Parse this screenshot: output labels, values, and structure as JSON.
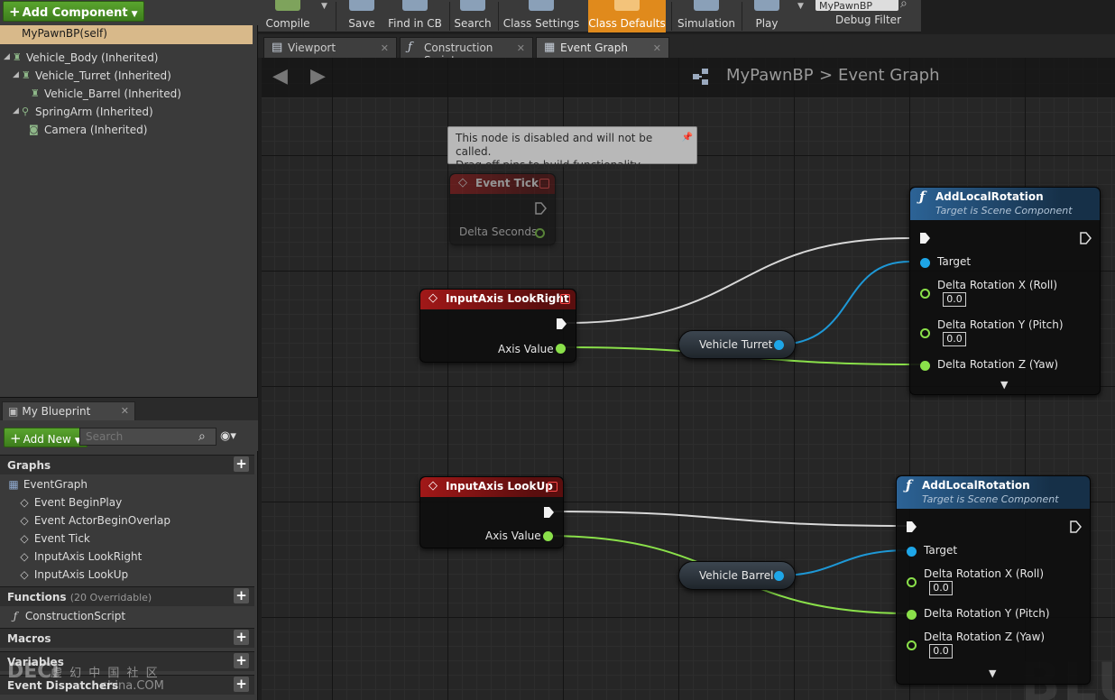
{
  "components": {
    "add_button": "Add Component",
    "self_row": "MyPawnBP(self)",
    "tree": [
      {
        "label": "Vehicle_Body (Inherited)",
        "expanded": true
      },
      {
        "label": "Vehicle_Turret (Inherited)",
        "expanded": true
      },
      {
        "label": "Vehicle_Barrel (Inherited)"
      },
      {
        "label": "SpringArm (Inherited)",
        "expanded": true
      },
      {
        "label": "Camera (Inherited)"
      }
    ]
  },
  "toolbar": {
    "compile": "Compile",
    "save": "Save",
    "find_in_cb": "Find in CB",
    "search": "Search",
    "class_settings": "Class Settings",
    "class_defaults": "Class Defaults",
    "simulation": "Simulation",
    "play": "Play",
    "debug_select": "MyPawnBP",
    "debug_filter": "Debug Filter",
    "accent_color": "#e08a1c"
  },
  "doc_tabs": [
    {
      "label": "Viewport"
    },
    {
      "label": "Construction Script"
    },
    {
      "label": "Event Graph"
    }
  ],
  "breadcrumb": {
    "blueprint": "MyPawnBP",
    "separator": ">",
    "graph": "Event Graph"
  },
  "my_blueprint": {
    "tab": "My Blueprint",
    "add_new": "Add New",
    "search_placeholder": "Search",
    "graphs_header": "Graphs",
    "graphs": [
      {
        "label": "EventGraph"
      },
      {
        "label": "Event BeginPlay"
      },
      {
        "label": "Event ActorBeginOverlap"
      },
      {
        "label": "Event Tick"
      },
      {
        "label": "InputAxis LookRight"
      },
      {
        "label": "InputAxis LookUp"
      }
    ],
    "functions_header": "Functions",
    "functions_sub": "(20 Overridable)",
    "functions": [
      {
        "label": "ConstructionScript"
      }
    ],
    "macros_header": "Macros",
    "variables_header": "Variables",
    "dispatchers_header": "Event Dispatchers"
  },
  "nodes": {
    "tooltip_line1": "This node is disabled and will not be called.",
    "tooltip_line2": "Drag off pins to build functionality.",
    "event_tick": {
      "title": "Event Tick",
      "pin": "Delta Seconds"
    },
    "look_right": {
      "title": "InputAxis LookRight",
      "pin": "Axis Value"
    },
    "look_up": {
      "title": "InputAxis LookUp",
      "pin": "Axis Value"
    },
    "var_turret": "Vehicle Turret",
    "var_barrel": "Vehicle Barrel",
    "add_rot_1": {
      "title": "AddLocalRotation",
      "subtitle": "Target is Scene Component",
      "target": "Target",
      "roll": "Delta Rotation X (Roll)",
      "roll_val": "0.0",
      "pitch": "Delta Rotation Y (Pitch)",
      "pitch_val": "0.0",
      "yaw": "Delta Rotation Z (Yaw)"
    },
    "add_rot_2": {
      "title": "AddLocalRotation",
      "subtitle": "Target is Scene Component",
      "target": "Target",
      "roll": "Delta Rotation X (Roll)",
      "roll_val": "0.0",
      "pitch": "Delta Rotation Y (Pitch)",
      "yaw": "Delta Rotation Z (Yaw)",
      "yaw_val": "0.0"
    }
  },
  "watermarks": {
    "logo": "DECI",
    "cn_text": "虚 幻 中 国 社 区",
    "domain": "china.COM",
    "graph_text": "BLU"
  }
}
